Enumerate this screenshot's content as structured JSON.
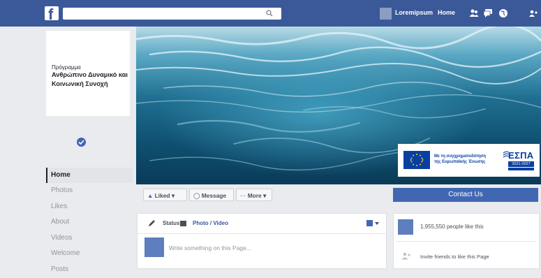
{
  "topbar": {
    "logo": "f",
    "search": {
      "value": "",
      "placeholder": ""
    },
    "user_name": "Loremipsum",
    "home_label": "Home",
    "icons": [
      "friends-icon",
      "messages-icon",
      "globe-icon",
      "settings-icon"
    ]
  },
  "profile": {
    "program_label": "Πρόγραμμα",
    "program_title": "Ανθρώπινο Δυναμικό και Κοινωνική Συνοχή"
  },
  "left_nav": {
    "items": [
      {
        "label": "Home",
        "active": true
      },
      {
        "label": "Photos"
      },
      {
        "label": "Likes"
      },
      {
        "label": "About"
      },
      {
        "label": "Videos"
      },
      {
        "label": "Welcome"
      },
      {
        "label": "Posts"
      }
    ]
  },
  "espa": {
    "line1": "Με τη συγχρηματοδότηση",
    "line2": "της Ευρωπαϊκής Ένωσης",
    "logo_text": "ΕΣΠΑ",
    "years": "2021-2027"
  },
  "actions": {
    "liked": "Liked",
    "message": "Message",
    "more": "More",
    "contact": "Contact Us"
  },
  "composer": {
    "status": "Status",
    "photo_video": "Photo / Video",
    "placeholder": "Write something on this Page..."
  },
  "likes_panel": {
    "count_text": "1,955,550 people like this",
    "invite_text": "Invite friends to like this Page"
  },
  "colors": {
    "brand": "#3b5998",
    "accent": "#4267b2",
    "eu_blue": "#0a3fa2",
    "background": "#e9ebee"
  }
}
